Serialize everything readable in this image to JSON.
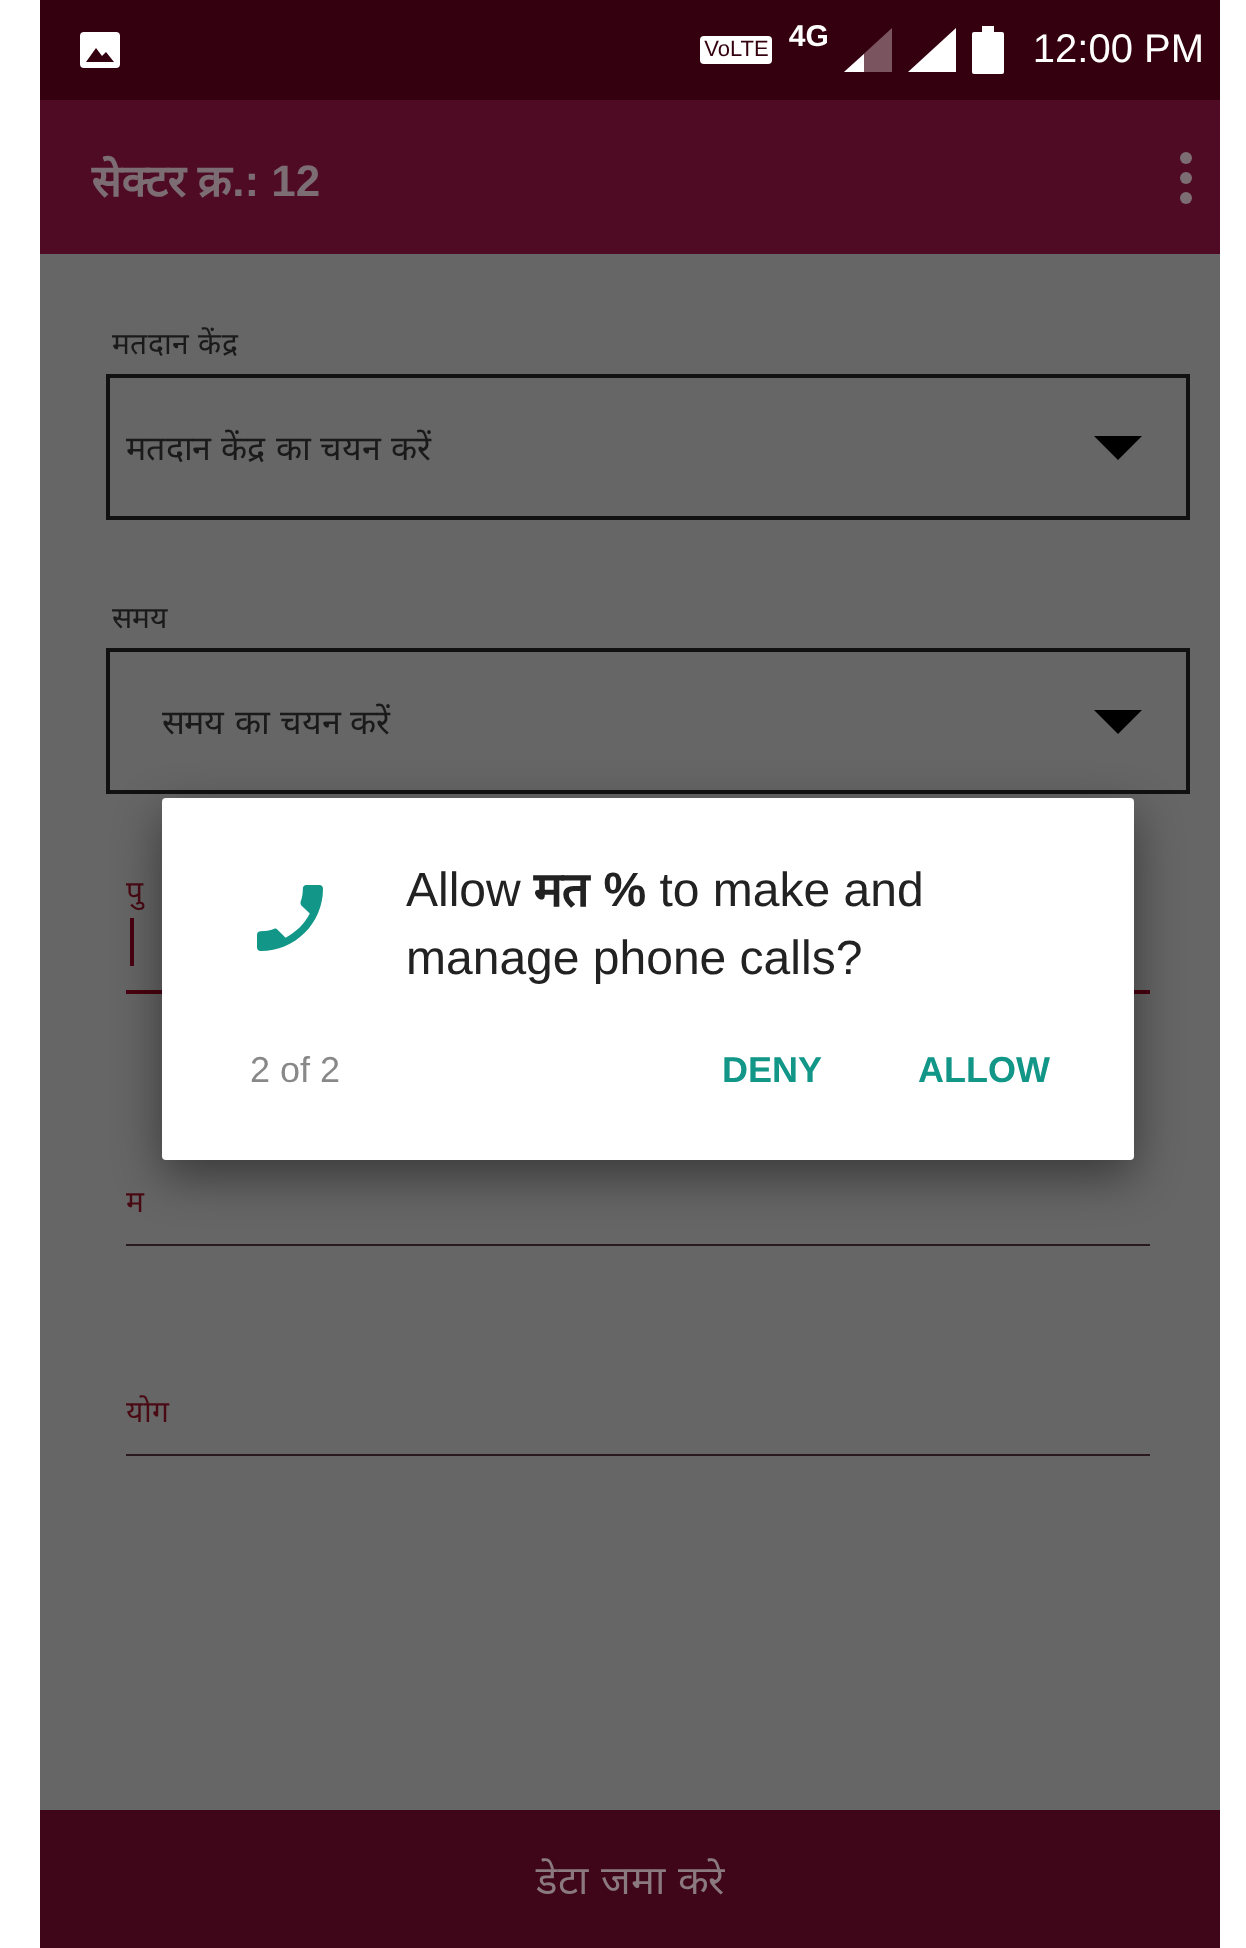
{
  "status_bar": {
    "volte": "VoLTE",
    "network": "4G",
    "time": "12:00 PM"
  },
  "toolbar": {
    "title": "सेक्टर क्र.: 12"
  },
  "fields": [
    {
      "kind": "dropdown",
      "label": "मतदान केंद्र",
      "placeholder": "मतदान केंद्र का चयन करें"
    },
    {
      "kind": "dropdown",
      "label": "समय",
      "placeholder": "समय का चयन करें"
    },
    {
      "kind": "text",
      "label": "पु",
      "focused": true
    },
    {
      "kind": "text",
      "label": "म",
      "focused": false
    },
    {
      "kind": "text",
      "label": "योग",
      "focused": false
    }
  ],
  "dialog": {
    "message": "Allow **मत %** to make and manage phone calls?",
    "counter": "2 of 2",
    "buttons": [
      "DENY",
      "ALLOW"
    ]
  },
  "submit_button": "डेटा जमा करे"
}
